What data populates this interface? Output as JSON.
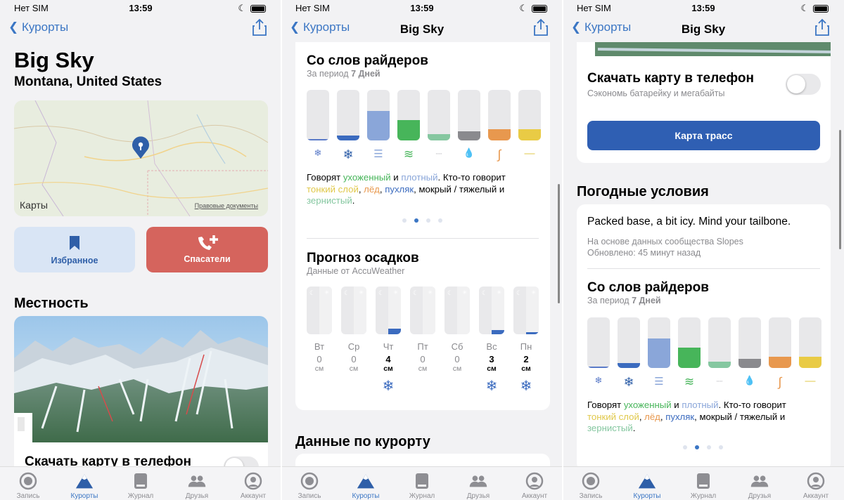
{
  "status": {
    "carrier": "Нет SIM",
    "time": "13:59"
  },
  "nav": {
    "back": "Курорты",
    "title": "Big Sky"
  },
  "resort": {
    "name": "Big Sky",
    "location": "Montana, United States"
  },
  "map": {
    "brand": "Карты",
    "legal": "Правовые документы"
  },
  "actions": {
    "favorite": "Избранное",
    "rescue": "Спасатели"
  },
  "terrain": {
    "title": "Местность"
  },
  "download": {
    "title": "Скачать карту в телефон",
    "subtitle": "Сэкономь батарейку и мегабайты"
  },
  "trail_map_button": "Карта трасс",
  "weather": {
    "title": "Погодные условия",
    "report": "Packed base, a bit icy. Mind your tailbone.",
    "source": "На основе данных сообщества Slopes",
    "updated": "Обновлено: 45 минут назад"
  },
  "riders": {
    "title": "Со слов райдеров",
    "period_prefix": "За период",
    "period_value": "7 Дней",
    "bars": [
      {
        "level": 0.02,
        "color": "#5a7ac8",
        "icon": "powder-icon"
      },
      {
        "level": 0.1,
        "color": "#3b6bbf",
        "icon": "snowflake-icon"
      },
      {
        "level": 0.58,
        "color": "#8aa6d9",
        "icon": "packed-icon"
      },
      {
        "level": 0.4,
        "color": "#47b55a",
        "icon": "groomed-icon"
      },
      {
        "level": 0.12,
        "color": "#85c7a0",
        "icon": "thin-cover-icon"
      },
      {
        "level": 0.18,
        "color": "#8a8a8e",
        "icon": "wet-heavy-icon"
      },
      {
        "level": 0.22,
        "color": "#e8984e",
        "icon": "icy-icon"
      },
      {
        "level": 0.22,
        "color": "#e9cb45",
        "icon": "thin-layer-icon"
      }
    ],
    "s1": "Говорят ",
    "w1": "ухоженный",
    "s2": " и ",
    "w2": "плотный",
    "s3": ". Кто-то говорит",
    "w3": "тонкий слой",
    "s4": ", ",
    "w4": "лёд",
    "s5": ", ",
    "w5": "пухляк",
    "s6": ", мокрый / тяжелый и",
    "w6": "зернистый",
    "s7": ".",
    "colors": {
      "groomed": "#47b55a",
      "packed": "#8aa6d9",
      "thin": "#e0c84a",
      "ice": "#e8984e",
      "powder": "#3b6bbf",
      "granular": "#85c7a0"
    }
  },
  "precip": {
    "title": "Прогноз осадков",
    "source": "Данные от AccuWeather",
    "days": [
      {
        "day": "Вт",
        "value": "0",
        "unit": "см",
        "level": 0,
        "snow": false,
        "bold": false
      },
      {
        "day": "Ср",
        "value": "0",
        "unit": "см",
        "level": 0,
        "snow": false,
        "bold": false
      },
      {
        "day": "Чт",
        "value": "4",
        "unit": "см",
        "level": 0.12,
        "snow": true,
        "bold": true
      },
      {
        "day": "Пт",
        "value": "0",
        "unit": "см",
        "level": 0,
        "snow": false,
        "bold": false
      },
      {
        "day": "Сб",
        "value": "0",
        "unit": "см",
        "level": 0,
        "snow": false,
        "bold": false
      },
      {
        "day": "Вс",
        "value": "3",
        "unit": "см",
        "level": 0.09,
        "snow": true,
        "bold": true
      },
      {
        "day": "Пн",
        "value": "2",
        "unit": "см",
        "level": 0.05,
        "snow": true,
        "bold": true
      }
    ]
  },
  "resort_data": {
    "title": "Данные по курорту"
  },
  "tabs": [
    "Запись",
    "Курорты",
    "Журнал",
    "Друзья",
    "Аккаунт"
  ],
  "accent": "#3b76c4"
}
